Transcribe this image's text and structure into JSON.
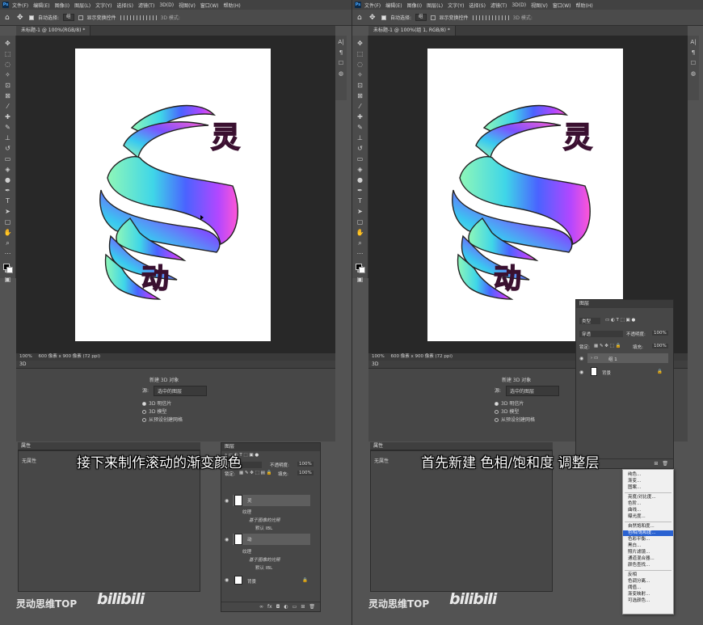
{
  "menu": [
    "文件(F)",
    "编辑(E)",
    "图像(I)",
    "图层(L)",
    "文字(Y)",
    "选择(S)",
    "滤镜(T)",
    "3D(D)",
    "视图(V)",
    "窗口(W)",
    "帮助(H)"
  ],
  "ps_logo": "Ps",
  "options": {
    "auto_select": "自动选择:",
    "auto_select_value": "组",
    "show_transform": "显示变换控件",
    "mode3d": "3D 模式:"
  },
  "left": {
    "doc_tab": "未标题-1 @ 100%(RGB/8) *",
    "status_zoom": "100%",
    "status_size": "600 像素 x 900 像素 (72 ppi)",
    "panel3d_title": "3D",
    "new3d_title": "新建 3D 对象",
    "source_label": "源:",
    "source_value": "选中的图层",
    "radio": [
      "3D 明信片",
      "3D 模型",
      "从预设创建网格"
    ],
    "props_title": "属性",
    "props_none": "无属性",
    "layers_title": "图层",
    "blend": "正常",
    "opacity_label": "不透明度:",
    "opacity": "100%",
    "lock_label": "锁定:",
    "fill_label": "填充:",
    "fill": "100%",
    "layer_ling": "灵",
    "layer_dong": "动",
    "texture": "纹理",
    "image_light": "基于图像的光照",
    "default_ibl": "默认 IBL",
    "background": "背景",
    "caption": "接下来制作滚动的渐变颜色",
    "watermark": "灵动思维TOP",
    "bili": "bilibili"
  },
  "right": {
    "doc_tab": "未标题-1 @ 100%(组 1, RGB/8) *",
    "status_zoom": "100%",
    "status_size": "600 像素 x 900 像素 (72 ppi)",
    "panel3d_title": "3D",
    "new3d_title": "新建 3D 对象",
    "source_label": "源:",
    "source_value": "选中的图层",
    "radio": [
      "3D 明信片",
      "3D 模型",
      "从预设创建网格"
    ],
    "props_title": "属性",
    "props_none": "无属性",
    "layers_title": "图层",
    "kind": "类型",
    "blend": "穿透",
    "opacity_label": "不透明度:",
    "opacity": "100%",
    "lock_label": "锁定:",
    "fill_label": "填充:",
    "fill": "100%",
    "group": "组 1",
    "background": "背景",
    "menu_items": [
      "纯色...",
      "渐变...",
      "图案...",
      "亮度/对比度...",
      "色阶...",
      "曲线...",
      "曝光度...",
      "自然饱和度...",
      "色相/饱和度...",
      "色彩平衡...",
      "黑白...",
      "照片滤镜...",
      "通道混合器...",
      "颜色查找...",
      "反相",
      "色调分离...",
      "阈值...",
      "渐变映射...",
      "可选颜色..."
    ],
    "caption": "首先新建 色相/饱和度 调整层",
    "watermark": "灵动思维TOP",
    "bili": "bilibili"
  },
  "art": {
    "char1": "灵",
    "char2": "动"
  },
  "colors": {
    "pink": "#e05ab8",
    "mint": "#7cf0b0",
    "violet": "#8a4dff",
    "blue": "#3b6cff",
    "highlight": "#2a62d1"
  }
}
